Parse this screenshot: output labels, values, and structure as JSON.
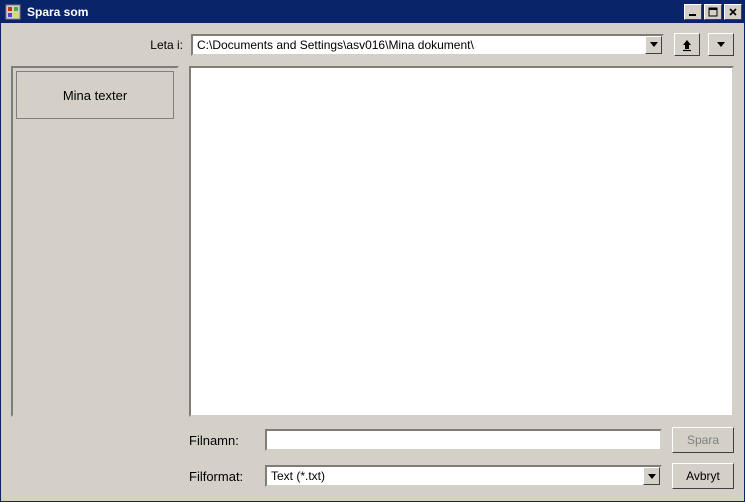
{
  "window": {
    "title": "Spara som"
  },
  "lookin": {
    "label": "Leta i:",
    "path": "C:\\Documents and Settings\\asv016\\Mina dokument\\"
  },
  "nav": {
    "up_icon": "up-folder-icon",
    "view_icon": "view-menu-icon"
  },
  "sidebar": {
    "items": [
      {
        "label": "Mina texter"
      }
    ]
  },
  "bottom": {
    "filename_label": "Filnamn:",
    "filename_value": "",
    "format_label": "Filformat:",
    "format_value": "Text (*.txt)",
    "save_label": "Spara",
    "cancel_label": "Avbryt"
  },
  "colors": {
    "titlebar": "#0a246a",
    "face": "#d4d0c8"
  }
}
